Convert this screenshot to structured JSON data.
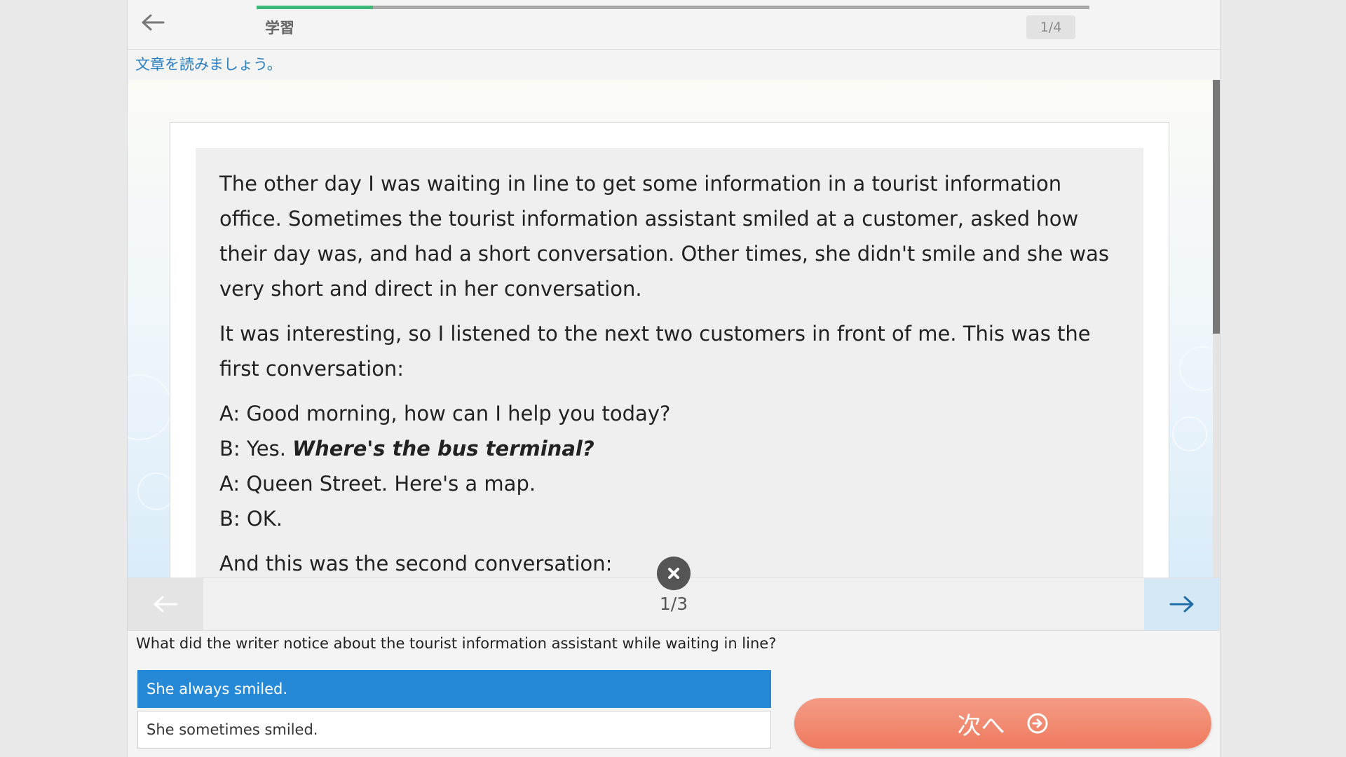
{
  "header": {
    "title": "学習",
    "page_counter": "1/4",
    "progress_fraction": 0.14
  },
  "instruction": "文章を読みましょう。",
  "passage": {
    "p1": "The other day I was waiting in line to get some information in a tourist information office. Sometimes the tourist information assistant smiled at a customer, asked how their day was, and had a short conversation. Other times, she didn't smile and she was very short and direct in her conversation.",
    "p2": "It was interesting, so I listened to the next two customers in front of me. This was the first conversation:",
    "line1": "A: Good morning, how can I help you today?",
    "line2_prefix": "B: Yes. ",
    "line2_emphasis": "Where's the bus terminal?",
    "line3": "A: Queen Street. Here's a map.",
    "line4": "B: OK.",
    "p3": "And this was the second conversation:"
  },
  "pager": {
    "counter": "1/3"
  },
  "question": {
    "text": "What did the writer notice about the tourist information assistant while waiting in line?",
    "options": [
      "She always smiled.",
      "She sometimes smiled."
    ],
    "selected_index": 0
  },
  "next_button": {
    "label": "次へ"
  },
  "icons": {
    "back": "arrow-left-icon",
    "close": "close-icon",
    "prev": "arrow-left-icon",
    "next": "arrow-right-icon",
    "next_button": "circle-arrow-right-icon"
  },
  "colors": {
    "accent_blue": "#2589d8",
    "progress_green": "#3cb878",
    "next_button": "#ee7a5e",
    "instruction_text": "#2b7fc0"
  }
}
